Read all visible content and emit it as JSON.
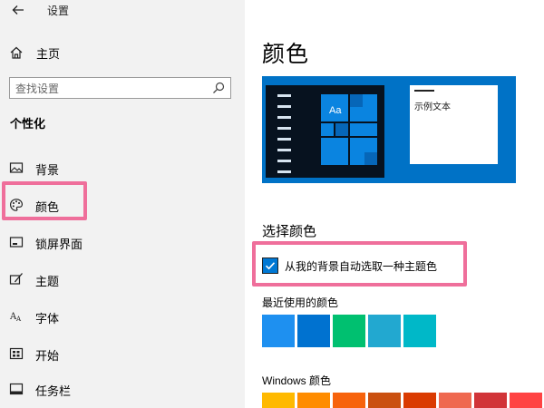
{
  "window": {
    "title": "设置"
  },
  "sidebar": {
    "home_label": "主页",
    "search_placeholder": "查找设置",
    "section_title": "个性化",
    "items": [
      {
        "label": "背景",
        "icon": "picture-icon"
      },
      {
        "label": "颜色",
        "icon": "palette-icon"
      },
      {
        "label": "锁屏界面",
        "icon": "lock-screen-icon"
      },
      {
        "label": "主题",
        "icon": "theme-brush-icon"
      },
      {
        "label": "字体",
        "icon": "font-icon"
      },
      {
        "label": "开始",
        "icon": "start-menu-icon"
      },
      {
        "label": "任务栏",
        "icon": "taskbar-icon"
      }
    ]
  },
  "main": {
    "title": "颜色",
    "preview": {
      "tile_text": "Aa",
      "sample_text": "示例文本"
    },
    "choose_title": "选择颜色",
    "auto_pick_label": "从我的背景自动选取一种主题色",
    "auto_pick_checked": true,
    "recent_title": "最近使用的颜色",
    "recent_colors": [
      "#1e90f0",
      "#0072d0",
      "#00c070",
      "#22a8d0",
      "#00b8c8"
    ],
    "windows_title": "Windows 颜色",
    "windows_colors": [
      "#ffb900",
      "#ff8c00",
      "#f7630c",
      "#ca5010",
      "#da3b01",
      "#ef6950",
      "#d13438",
      "#ff4343"
    ]
  },
  "colors": {
    "highlight": "#ef6f9b",
    "accent": "#0078d4",
    "sidebar_bg": "#f2f2f2"
  }
}
